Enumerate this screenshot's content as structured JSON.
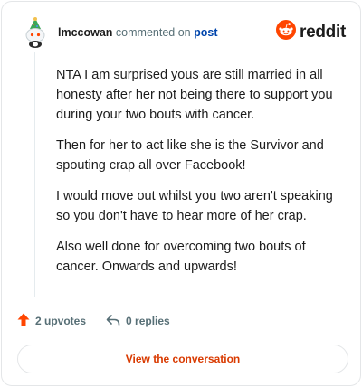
{
  "header": {
    "username": "lmccowan",
    "action_text": "commented on",
    "target_link": "post",
    "avatar_icon": "snoo-party-hat-avatar-icon"
  },
  "brand": {
    "icon": "reddit-logo-icon",
    "wordmark": "reddit",
    "accent_color": "#ff4500"
  },
  "comment": {
    "paragraphs": [
      "NTA I am surprised yous are still married in all honesty after her not being there to support you during your two bouts with cancer.",
      "Then for her to act like she is the Survivor and spouting crap all over Facebook!",
      "I would move out whilst you two aren't speaking so you don't have to hear more of her crap.",
      "Also well done for overcoming two bouts of cancer. Onwards and upwards!"
    ]
  },
  "actions": {
    "upvotes_label": "2 upvotes",
    "upvote_icon": "upvote-arrow-icon",
    "replies_label": "0 replies",
    "reply_icon": "reply-arrow-icon"
  },
  "cta": {
    "label": "View the conversation",
    "color": "#d93a00"
  }
}
